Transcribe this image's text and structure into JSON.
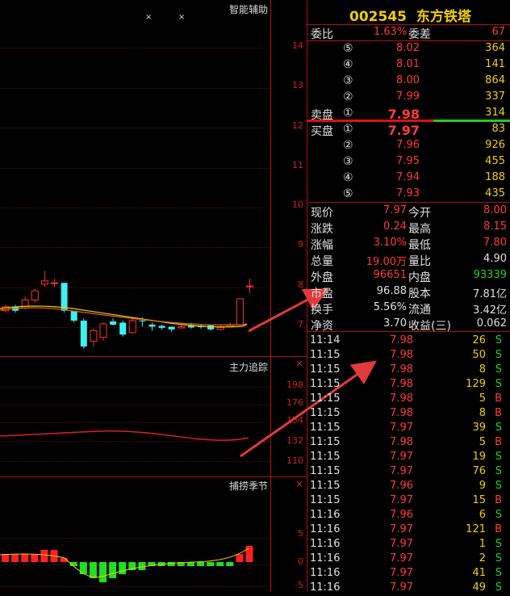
{
  "stock": {
    "code": "002545",
    "name": "东方铁塔"
  },
  "panels": {
    "main_title": "智能辅助",
    "tracking_title": "主力追踪",
    "season_title": "捕捞季节"
  },
  "main_axis": [
    "14",
    "13",
    "12",
    "11",
    "10",
    "9",
    "8",
    "7"
  ],
  "tracking_axis": [
    "198",
    "176",
    "154",
    "132",
    "110"
  ],
  "season_axis": [
    "5",
    "0",
    "-5"
  ],
  "close_glyph": "×",
  "weibi": {
    "label": "委比",
    "value": "1.63%",
    "diff_label": "委差",
    "diff": "67"
  },
  "sell_label": "卖盘",
  "buy_label": "买盘",
  "asks": [
    {
      "lvl": "⑤",
      "price": "8.02",
      "vol": "364"
    },
    {
      "lvl": "④",
      "price": "8.01",
      "vol": "141"
    },
    {
      "lvl": "③",
      "price": "8.00",
      "vol": "864"
    },
    {
      "lvl": "②",
      "price": "7.99",
      "vol": "337"
    },
    {
      "lvl": "①",
      "price": "7.98",
      "vol": "314"
    }
  ],
  "bids": [
    {
      "lvl": "①",
      "price": "7.97",
      "vol": "83"
    },
    {
      "lvl": "②",
      "price": "7.96",
      "vol": "926"
    },
    {
      "lvl": "③",
      "price": "7.95",
      "vol": "455"
    },
    {
      "lvl": "④",
      "price": "7.94",
      "vol": "188"
    },
    {
      "lvl": "⑤",
      "price": "7.93",
      "vol": "435"
    }
  ],
  "quote": [
    {
      "l1": "现价",
      "v1": "7.97",
      "l2": "今开",
      "v2": "8.00"
    },
    {
      "l1": "涨跌",
      "v1": "0.24",
      "l2": "最高",
      "v2": "8.15"
    },
    {
      "l1": "涨幅",
      "v1": "3.10%",
      "l2": "最低",
      "v2": "7.80"
    },
    {
      "l1": "总量",
      "v1": "19.00万",
      "l2": "量比",
      "v2": "4.90"
    },
    {
      "l1": "外盘",
      "v1": "96651",
      "l2": "内盘",
      "v2": "93339"
    },
    {
      "l1": "市盈",
      "v1": "96.88",
      "l2": "股本",
      "v2": "7.81亿"
    },
    {
      "l1": "换手",
      "v1": "5.56%",
      "l2": "流通",
      "v2": "3.42亿"
    },
    {
      "l1": "净资",
      "v1": "3.70",
      "l2": "收益(三)",
      "v2": "0.062"
    }
  ],
  "ticks": [
    {
      "t": "11:14",
      "p": "7.98",
      "v": "26",
      "s": "S"
    },
    {
      "t": "11:15",
      "p": "7.98",
      "v": "50",
      "s": "S"
    },
    {
      "t": "11:15",
      "p": "7.98",
      "v": "8",
      "s": "S"
    },
    {
      "t": "11:15",
      "p": "7.98",
      "v": "129",
      "s": "S"
    },
    {
      "t": "11:15",
      "p": "7.98",
      "v": "5",
      "s": "B"
    },
    {
      "t": "11:15",
      "p": "7.98",
      "v": "8",
      "s": "B"
    },
    {
      "t": "11:15",
      "p": "7.97",
      "v": "39",
      "s": "S"
    },
    {
      "t": "11:15",
      "p": "7.98",
      "v": "5",
      "s": "B"
    },
    {
      "t": "11:15",
      "p": "7.97",
      "v": "19",
      "s": "S"
    },
    {
      "t": "11:15",
      "p": "7.97",
      "v": "76",
      "s": "S"
    },
    {
      "t": "11:15",
      "p": "7.96",
      "v": "9",
      "s": "S"
    },
    {
      "t": "11:15",
      "p": "7.97",
      "v": "15",
      "s": "B"
    },
    {
      "t": "11:16",
      "p": "7.96",
      "v": "6",
      "s": "S"
    },
    {
      "t": "11:16",
      "p": "7.97",
      "v": "121",
      "s": "B"
    },
    {
      "t": "11:16",
      "p": "7.97",
      "v": "1",
      "s": "S"
    },
    {
      "t": "11:16",
      "p": "7.97",
      "v": "2",
      "s": "S"
    },
    {
      "t": "11:16",
      "p": "7.97",
      "v": "41",
      "s": "S"
    },
    {
      "t": "11:16",
      "p": "7.97",
      "v": "49",
      "s": "S"
    }
  ],
  "candles": [
    {
      "o": 7.35,
      "c": 7.45,
      "h": 7.5,
      "l": 7.3
    },
    {
      "o": 7.45,
      "c": 7.35,
      "h": 7.5,
      "l": 7.3
    },
    {
      "o": 7.42,
      "c": 7.62,
      "h": 7.7,
      "l": 7.38
    },
    {
      "o": 7.62,
      "c": 7.85,
      "h": 7.9,
      "l": 7.55
    },
    {
      "o": 8.02,
      "c": 8.1,
      "h": 8.35,
      "l": 7.95
    },
    {
      "o": 8.05,
      "c": 8.05,
      "h": 8.15,
      "l": 7.95
    },
    {
      "o": 8.05,
      "c": 7.35,
      "h": 8.05,
      "l": 7.3
    },
    {
      "o": 7.35,
      "c": 7.1,
      "h": 7.35,
      "l": 7.05
    },
    {
      "o": 7.1,
      "c": 6.45,
      "h": 7.15,
      "l": 6.4
    },
    {
      "o": 6.58,
      "c": 6.85,
      "h": 6.9,
      "l": 6.45
    },
    {
      "o": 6.68,
      "c": 7.02,
      "h": 7.05,
      "l": 6.6
    },
    {
      "o": 7.08,
      "c": 7.0,
      "h": 7.15,
      "l": 6.98
    },
    {
      "o": 7.05,
      "c": 6.75,
      "h": 7.1,
      "l": 6.7
    },
    {
      "o": 6.8,
      "c": 7.1,
      "h": 7.15,
      "l": 6.78
    },
    {
      "o": 7.1,
      "c": 7.08,
      "h": 7.18,
      "l": 6.95
    },
    {
      "o": 7.0,
      "c": 6.95,
      "h": 7.05,
      "l": 6.85
    },
    {
      "o": 6.97,
      "c": 6.92,
      "h": 7.0,
      "l": 6.88
    },
    {
      "o": 6.95,
      "c": 6.88,
      "h": 6.95,
      "l": 6.82
    },
    {
      "o": 6.92,
      "c": 6.95,
      "h": 7.0,
      "l": 6.9
    },
    {
      "o": 6.97,
      "c": 6.93,
      "h": 7.05,
      "l": 6.9
    },
    {
      "o": 6.96,
      "c": 6.94,
      "h": 7.02,
      "l": 6.9
    },
    {
      "o": 6.98,
      "c": 6.88,
      "h": 7.0,
      "l": 6.85
    },
    {
      "o": 6.88,
      "c": 6.93,
      "h": 7.0,
      "l": 6.86
    },
    {
      "o": 6.96,
      "c": 7.0,
      "h": 7.05,
      "l": 6.94
    },
    {
      "o": 7.0,
      "c": 7.65,
      "h": 7.65,
      "l": 6.95
    },
    {
      "o": 7.97,
      "c": 7.97,
      "h": 8.15,
      "l": 7.8
    }
  ],
  "season_bars": [
    2,
    2,
    2,
    2,
    3,
    3,
    1,
    -1,
    -3,
    -4,
    -5,
    -4,
    -3,
    -2,
    -2,
    -1,
    -1,
    -1,
    -1,
    -1,
    -1,
    -1,
    -1,
    -1,
    2,
    4
  ]
}
